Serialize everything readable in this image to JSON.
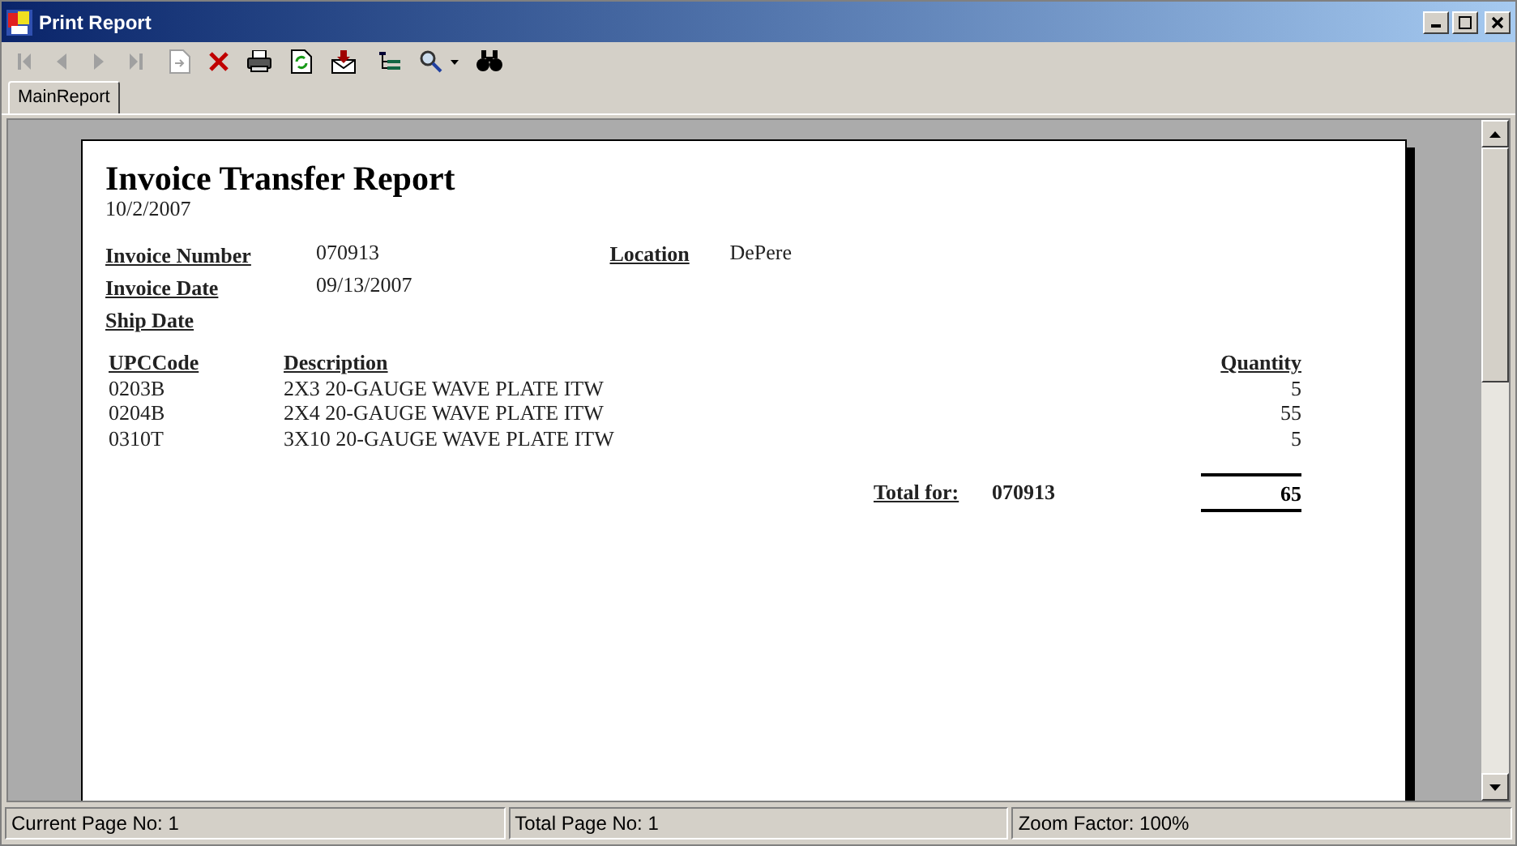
{
  "window": {
    "title": "Print Report"
  },
  "toolbar": [
    {
      "kind": "first",
      "disabled": true
    },
    {
      "kind": "previous",
      "disabled": true
    },
    {
      "kind": "next",
      "disabled": true
    },
    {
      "kind": "last",
      "disabled": true
    },
    {
      "kind": "goto",
      "disabled": true
    },
    {
      "kind": "close",
      "disabled": false
    },
    {
      "kind": "print",
      "disabled": false
    },
    {
      "kind": "refresh",
      "disabled": false
    },
    {
      "kind": "export",
      "disabled": false
    },
    {
      "kind": "tree",
      "disabled": false
    },
    {
      "kind": "zoom",
      "disabled": false
    },
    {
      "kind": "search",
      "disabled": false
    }
  ],
  "tabs": [
    {
      "label": "MainReport",
      "selected": true
    }
  ],
  "report": {
    "title": "Invoice Transfer Report",
    "date": "10/2/2007",
    "fields": [
      {
        "label": "Invoice Number",
        "value": "070913"
      },
      {
        "label": "Invoice Date",
        "value": "09/13/2007"
      },
      {
        "label": "Ship Date"
      }
    ],
    "location": {
      "label": "Location",
      "value": "DePere"
    },
    "columns": [
      "UPCCode",
      "Description",
      "Quantity"
    ],
    "rows": [
      [
        "0203B",
        "2X3 20-GAUGE WAVE PLATE ITW",
        "5"
      ],
      [
        "0204B",
        "2X4 20-GAUGE WAVE PLATE ITW",
        "55"
      ],
      [
        "0310T",
        "3X10 20-GAUGE WAVE PLATE ITW",
        "5"
      ]
    ],
    "total": {
      "label": "Total for:",
      "key": "070913",
      "value": "65"
    }
  },
  "status_bar": [
    "Current Page No: 1",
    "Total Page No: 1",
    "Zoom Factor: 100%"
  ]
}
